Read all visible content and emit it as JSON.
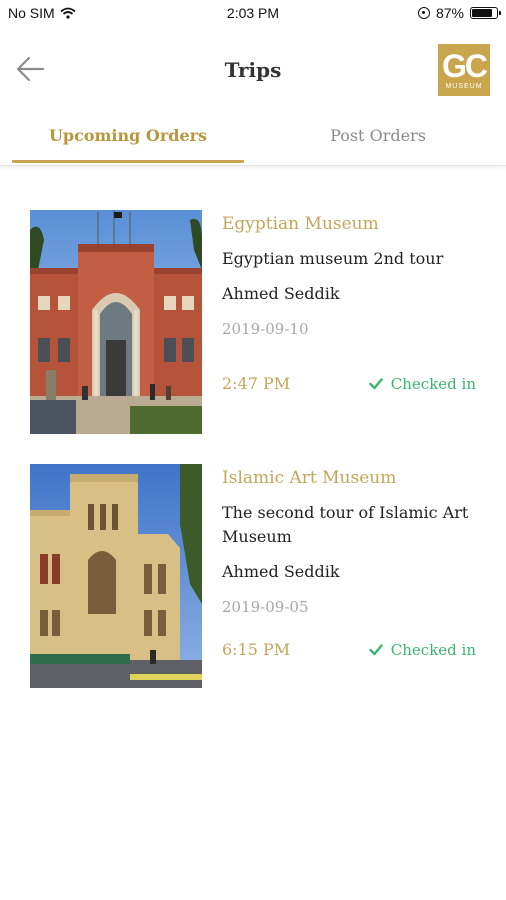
{
  "status_bar": {
    "carrier": "No SIM",
    "time": "2:03 PM",
    "battery_text": "87%",
    "battery_level": 0.87
  },
  "header": {
    "title": "Trips",
    "back_icon": "arrow-left-icon",
    "logo_monogram": "GC",
    "logo_word": "MUSEUM",
    "brand_color": "#c9a54d"
  },
  "tabs": [
    {
      "label": "Upcoming Orders",
      "active": true
    },
    {
      "label": "Post Orders",
      "active": false
    }
  ],
  "orders": [
    {
      "museum": "Egyptian Museum",
      "description": "Egyptian museum 2nd tour",
      "guide": "Ahmed Seddik",
      "date": "2019-09-10",
      "time": "2:47 PM",
      "status": "Checked in",
      "status_icon": "checkmark-icon"
    },
    {
      "museum": "Islamic Art Museum",
      "description": "The second tour of Islamic Art Museum",
      "guide": "Ahmed Seddik",
      "date": "2019-09-05",
      "time": "6:15 PM",
      "status": "Checked in",
      "status_icon": "checkmark-icon"
    }
  ],
  "colors": {
    "accent": "#c4a65a",
    "checked_in": "#3cb66f",
    "muted": "#a7a7a7"
  }
}
